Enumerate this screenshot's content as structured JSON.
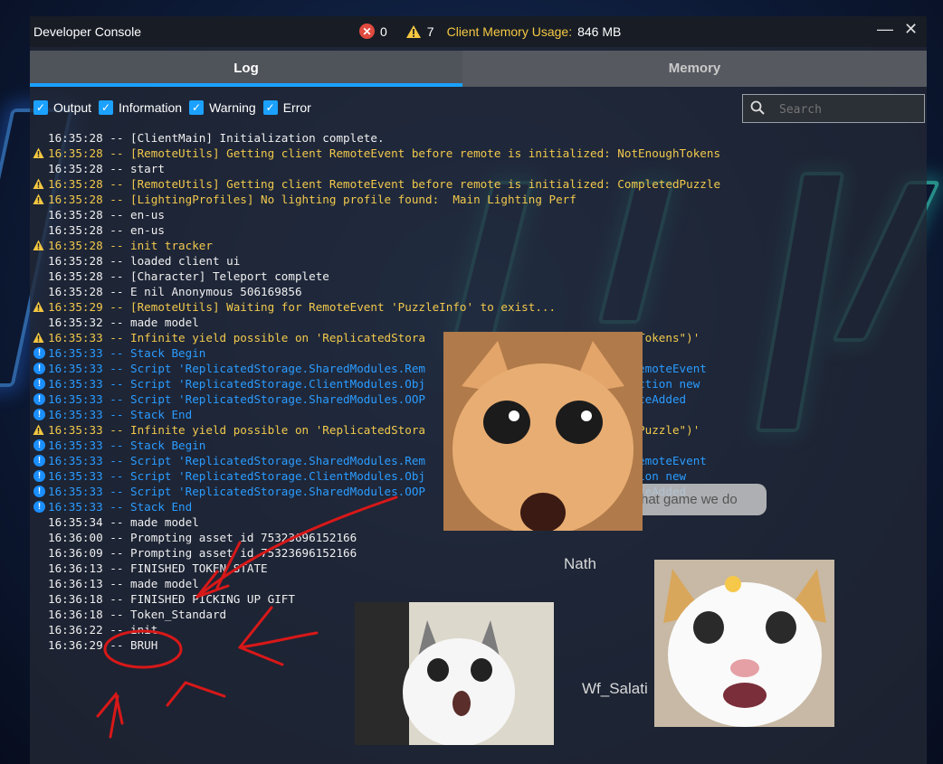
{
  "titlebar": {
    "title": "Developer Console",
    "error_count": "0",
    "warning_count": "7",
    "memory_label": "Client Memory Usage:",
    "memory_value": "846 MB"
  },
  "tabs": [
    {
      "label": "Log",
      "active": true
    },
    {
      "label": "Memory",
      "active": false
    }
  ],
  "filters": [
    {
      "label": "Output",
      "checked": true
    },
    {
      "label": "Information",
      "checked": true
    },
    {
      "label": "Warning",
      "checked": true
    },
    {
      "label": "Error",
      "checked": true
    }
  ],
  "search": {
    "placeholder": "Search"
  },
  "log": [
    {
      "level": "output",
      "text": "16:35:28 -- [ClientMain] Initialization complete."
    },
    {
      "level": "warning",
      "text": "16:35:28 -- [RemoteUtils] Getting client RemoteEvent before remote is initialized: NotEnoughTokens"
    },
    {
      "level": "output",
      "text": "16:35:28 -- start"
    },
    {
      "level": "warning",
      "text": "16:35:28 -- [RemoteUtils] Getting client RemoteEvent before remote is initialized: CompletedPuzzle"
    },
    {
      "level": "warning",
      "text": "16:35:28 -- [LightingProfiles] No lighting profile found:  Main Lighting Perf"
    },
    {
      "level": "output",
      "text": "16:35:28 -- en-us"
    },
    {
      "level": "output",
      "text": "16:35:28 -- en-us"
    },
    {
      "level": "warning",
      "text": "16:35:28 -- init tracker"
    },
    {
      "level": "output",
      "text": "16:35:28 -- loaded client ui"
    },
    {
      "level": "output",
      "text": "16:35:28 -- [Character] Teleport complete"
    },
    {
      "level": "output",
      "text": "16:35:28 -- E nil Anonymous 506169856"
    },
    {
      "level": "warning",
      "text": "16:35:29 -- [RemoteUtils] Waiting for RemoteEvent 'PuzzleInfo' to exist..."
    },
    {
      "level": "output",
      "text": "16:35:32 -- made model"
    },
    {
      "level": "warning",
      "text": "16:35:33 -- Infinite yield possible on 'ReplicatedStora                        tEnoughTokens\")'"
    },
    {
      "level": "info",
      "text": "16:35:33 -- Stack Begin"
    },
    {
      "level": "info",
      "text": "16:35:33 -- Script 'ReplicatedStorage.SharedModules.Rem                        on GetRemoteEvent"
    },
    {
      "level": "info",
      "text": "16:35:33 -- Script 'ReplicatedStorage.ClientModules.Obj                        1 - function new"
    },
    {
      "level": "info",
      "text": "16:35:33 -- Script 'ReplicatedStorage.SharedModules.OOP                        nInstanceAdded"
    },
    {
      "level": "info",
      "text": "16:35:33 -- Stack End"
    },
    {
      "level": "warning",
      "text": "16:35:33 -- Infinite yield possible on 'ReplicatedStora                        mpletedPuzzle\")'"
    },
    {
      "level": "info",
      "text": "16:35:33 -- Stack Begin"
    },
    {
      "level": "info",
      "text": "16:35:33 -- Script 'ReplicatedStorage.SharedModules.Rem                        on GetRemoteEvent"
    },
    {
      "level": "info",
      "text": "16:35:33 -- Script 'ReplicatedStorage.ClientModules.Obj                        - function new"
    },
    {
      "level": "info",
      "text": "16:35:33 -- Script 'ReplicatedStorage.SharedModules.OOP                        nInstanceAdded"
    },
    {
      "level": "info",
      "text": "16:35:33 -- Stack End"
    },
    {
      "level": "output",
      "text": "16:35:34 -- made model"
    },
    {
      "level": "output",
      "text": "16:36:00 -- Prompting asset id 75323696152166"
    },
    {
      "level": "output",
      "text": "16:36:09 -- Prompting asset id 75323696152166"
    },
    {
      "level": "output",
      "text": "16:36:13 -- FINISHED TOKEN STATE"
    },
    {
      "level": "output",
      "text": "16:36:13 -- made model"
    },
    {
      "level": "output",
      "text": "16:36:18 -- FINISHED PICKING UP GIFT"
    },
    {
      "level": "output",
      "text": "16:36:18 -- Token_Standard"
    },
    {
      "level": "output",
      "text": "16:36:22 -- init"
    },
    {
      "level": "output",
      "text": "16:36:29 -- BRUH"
    }
  ],
  "ingame": {
    "player_name_1": "Nath",
    "player_name_2": "Wf_Salati",
    "chat_bubble": "hat game we do"
  },
  "colors": {
    "accent": "#1ba1ff",
    "warning": "#f2c94c",
    "info": "#2b9cff",
    "error": "#e04a3f",
    "annotation_red": "#d81818"
  },
  "icons": [
    "error-icon",
    "warning-icon",
    "info-icon",
    "search-icon",
    "minimize-icon",
    "close-icon",
    "checkbox-icon"
  ]
}
